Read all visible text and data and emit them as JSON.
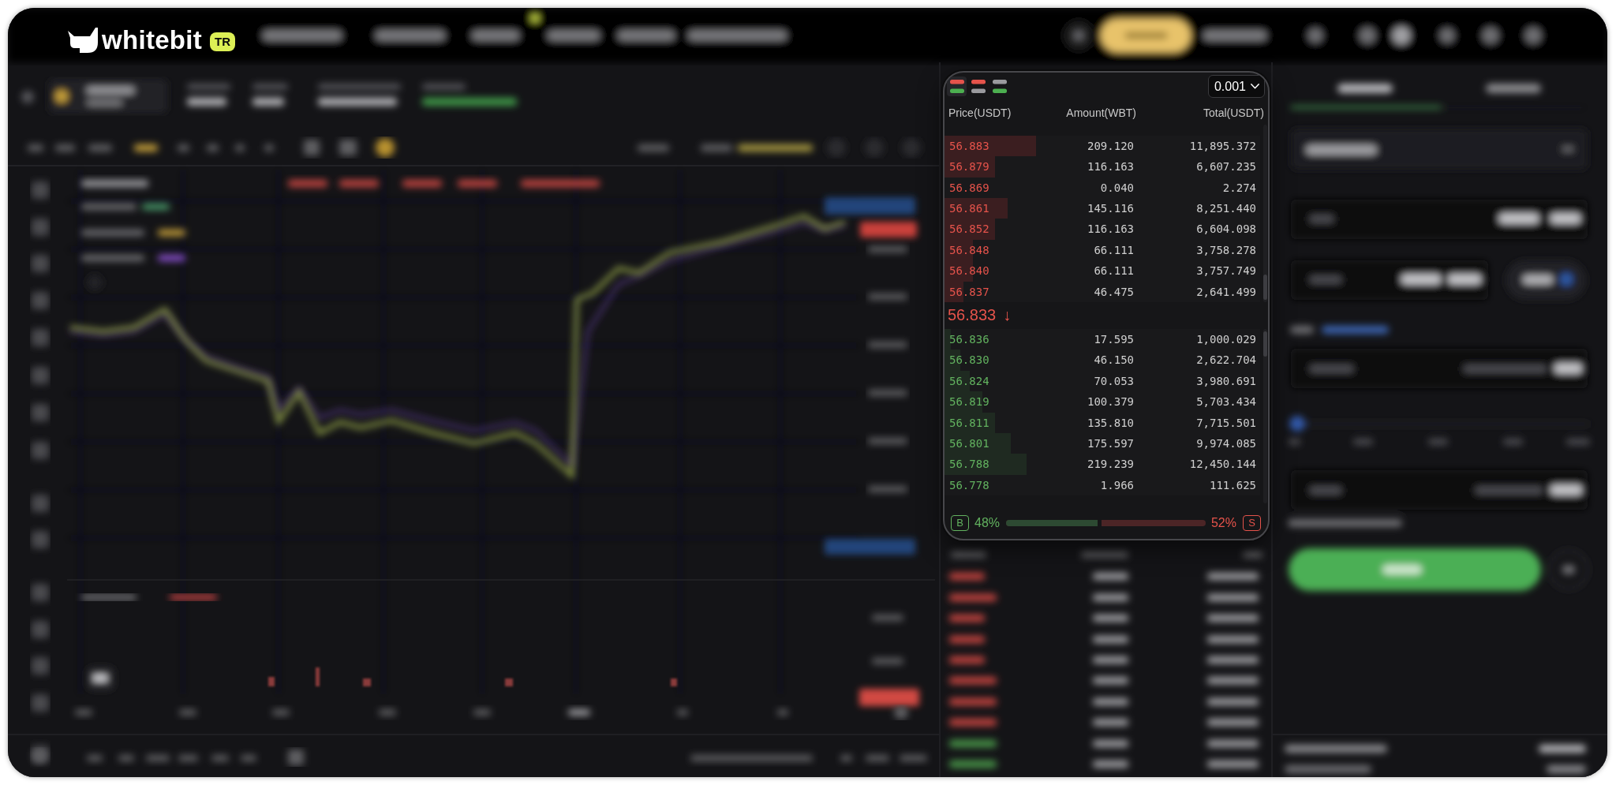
{
  "logo": {
    "wordmark": "whitebit",
    "badge": "TR"
  },
  "order_book": {
    "view_modes": [
      {
        "kind": "both",
        "selected": true
      },
      {
        "kind": "asks",
        "selected": false
      },
      {
        "kind": "bids",
        "selected": false
      }
    ],
    "precision": {
      "value": "0.001"
    },
    "columns": [
      "Price(USDT)",
      "Amount(WBT)",
      "Total(USDT)"
    ],
    "asks": [
      {
        "price": "56.883",
        "amount": "209.120",
        "total": "11,895.372",
        "level": 0.29
      },
      {
        "price": "56.879",
        "amount": "116.163",
        "total": "6,607.235",
        "level": 0.16
      },
      {
        "price": "56.869",
        "amount": "0.040",
        "total": "2.274"
      },
      {
        "price": "56.861",
        "amount": "145.116",
        "total": "8,251.440",
        "level": 0.2
      },
      {
        "price": "56.852",
        "amount": "116.163",
        "total": "6,604.098",
        "level": 0.16
      },
      {
        "price": "56.848",
        "amount": "66.111",
        "total": "3,758.278",
        "level": 0.09
      },
      {
        "price": "56.840",
        "amount": "66.111",
        "total": "3,757.749",
        "level": 0.09
      },
      {
        "price": "56.837",
        "amount": "46.475",
        "total": "2,641.499",
        "level": 0.06
      }
    ],
    "last_price": {
      "value": "56.833",
      "arrow": "↓",
      "falling": true
    },
    "bids": [
      {
        "price": "56.836",
        "amount": "17.595",
        "total": "1,000.029",
        "level": 0.02
      },
      {
        "price": "56.830",
        "amount": "46.150",
        "total": "2,622.704",
        "level": 0.05
      },
      {
        "price": "56.824",
        "amount": "70.053",
        "total": "3,980.691",
        "level": 0.08
      },
      {
        "price": "56.819",
        "amount": "100.379",
        "total": "5,703.434",
        "level": 0.12
      },
      {
        "price": "56.811",
        "amount": "135.810",
        "total": "7,715.501",
        "level": 0.16
      },
      {
        "price": "56.801",
        "amount": "175.597",
        "total": "9,974.085",
        "level": 0.21
      },
      {
        "price": "56.788",
        "amount": "219.239",
        "total": "12,450.144",
        "level": 0.26
      },
      {
        "price": "56.778",
        "amount": "1.966",
        "total": "111.625"
      }
    ],
    "ratio": {
      "buy_label": "B",
      "buy_percent": "48%",
      "sell_percent": "52%",
      "sell_label": "S",
      "level": 0.48
    }
  }
}
